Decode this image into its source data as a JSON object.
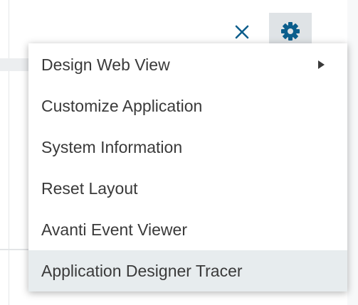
{
  "toolbar": {
    "close_icon": "close-icon",
    "settings_icon": "gear-icon",
    "accent_color": "#0b5e8c"
  },
  "menu": {
    "items": [
      {
        "label": "Design Web View",
        "has_submenu": true
      },
      {
        "label": "Customize Application",
        "has_submenu": false
      },
      {
        "label": "System Information",
        "has_submenu": false
      },
      {
        "label": "Reset Layout",
        "has_submenu": false
      },
      {
        "label": "Avanti Event Viewer",
        "has_submenu": false
      },
      {
        "label": "Application Designer Tracer",
        "has_submenu": false,
        "highlighted": true
      }
    ]
  }
}
